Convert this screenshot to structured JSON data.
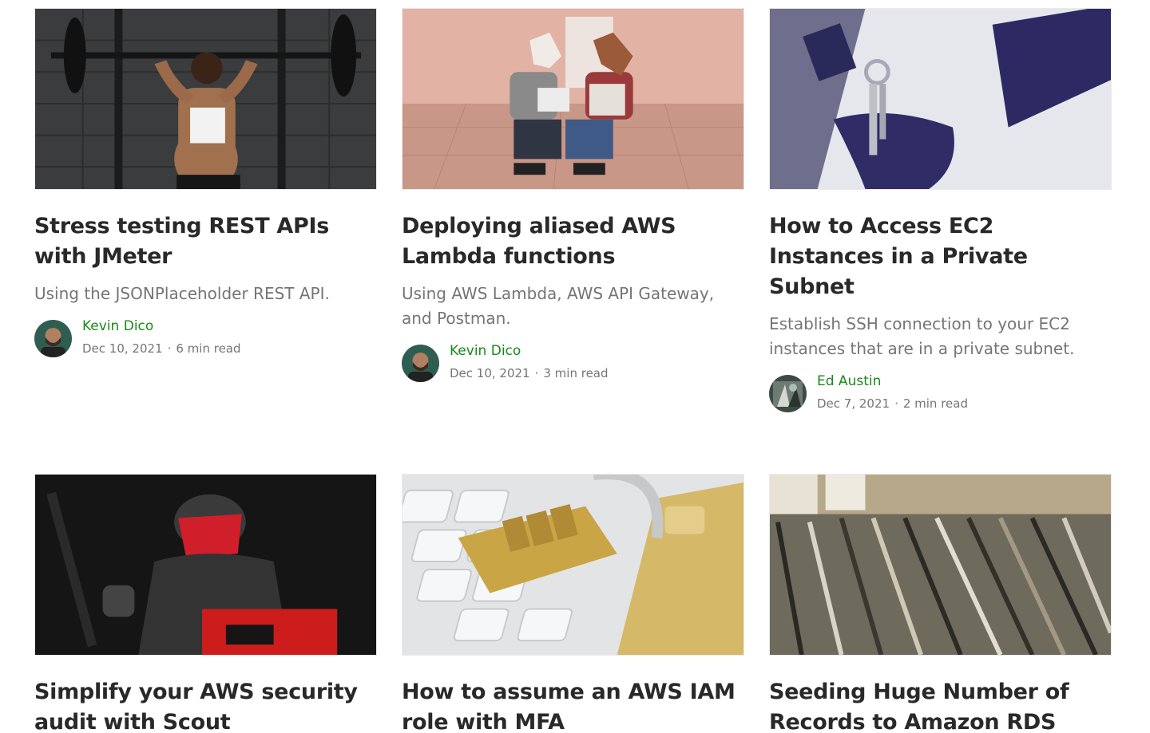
{
  "articles": [
    {
      "image": "woman-lifting-barbell",
      "title": "Stress testing REST APIs with JMeter",
      "subtitle": "Using the JSONPlaceholder REST API.",
      "author": "Kevin Dico",
      "date": "Dec 10, 2021",
      "read_time": "6 min read"
    },
    {
      "image": "horse-masks-accordion",
      "title": "Deploying aliased AWS Lambda functions",
      "subtitle": "Using AWS Lambda, AWS API Gateway, and Postman.",
      "author": "Kevin Dico",
      "date": "Dec 10, 2021",
      "read_time": "3 min read"
    },
    {
      "image": "keys-in-lock",
      "title": "How to Access EC2 Instances in a Private Subnet",
      "subtitle": "Establish SSH connection to your EC2 instances that are in a private subnet.",
      "author": "Ed Austin",
      "date": "Dec 7, 2021",
      "read_time": "2 min read"
    },
    {
      "image": "riot-police-figure",
      "title": "Simplify your AWS security audit with Scout",
      "subtitle": "",
      "author": "",
      "date": "",
      "read_time": ""
    },
    {
      "image": "padlock-on-keyboard",
      "title": "How to assume an AWS IAM role with MFA",
      "subtitle": "",
      "author": "",
      "date": "",
      "read_time": ""
    },
    {
      "image": "record-bins",
      "title": "Seeding Huge Number of Records to Amazon RDS",
      "subtitle": "",
      "author": "",
      "date": "",
      "read_time": ""
    }
  ],
  "colors": {
    "title": "#292929",
    "subtitle": "#757575",
    "author": "#1a8917"
  }
}
